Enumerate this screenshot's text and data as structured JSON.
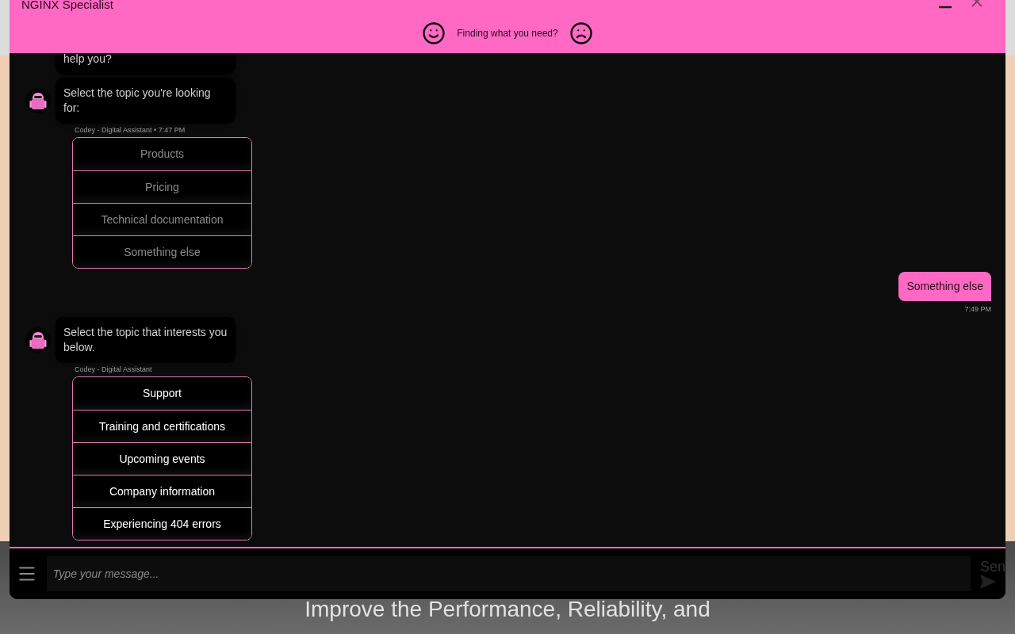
{
  "widget": {
    "title": "NGINX Specialist",
    "feedback": {
      "prompt": "Finding what you need?"
    },
    "messages": [
      {
        "kind": "bot",
        "text": "help you?"
      },
      {
        "kind": "bot",
        "text": "Select the topic you're looking for:",
        "meta": "Codey - Digital Assistant • 7:47 PM",
        "options": [
          {
            "label": "Products",
            "disabled": true
          },
          {
            "label": "Pricing",
            "disabled": true
          },
          {
            "label": "Technical documentation",
            "disabled": true
          },
          {
            "label": "Something else",
            "disabled": true
          }
        ]
      },
      {
        "kind": "user",
        "text": "Something else",
        "meta": "7:49 PM"
      },
      {
        "kind": "bot",
        "text": "Select the topic that interests you below.",
        "meta": "Codey - Digital Assistant",
        "options": [
          {
            "label": "Support",
            "disabled": false
          },
          {
            "label": "Training and certifications",
            "disabled": false
          },
          {
            "label": "Upcoming events",
            "disabled": false
          },
          {
            "label": "Company information",
            "disabled": false
          },
          {
            "label": "Experiencing 404 errors",
            "disabled": false
          }
        ]
      }
    ],
    "composer": {
      "placeholder": "Type your message...",
      "send_label": "Sen"
    }
  },
  "page": {
    "headline": [
      "Improve the Performance, Reliability, and"
    ]
  }
}
